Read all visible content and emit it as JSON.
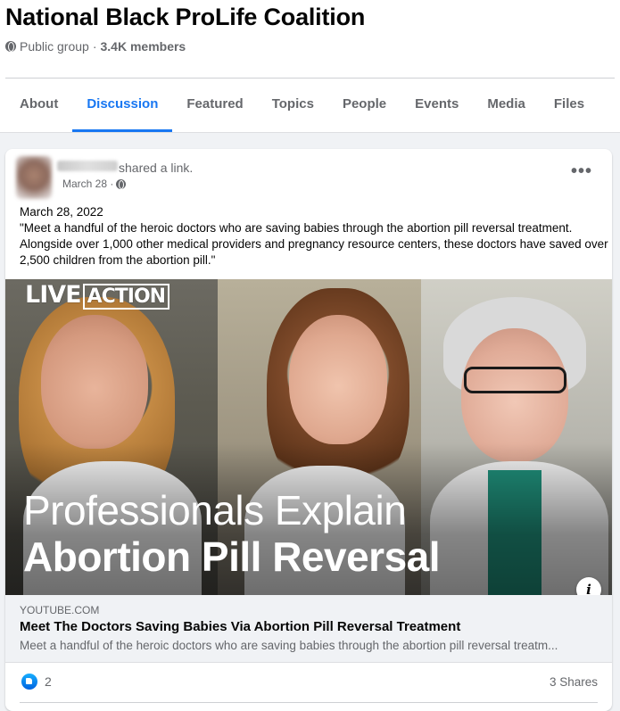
{
  "group": {
    "title": "National Black ProLife Coalition",
    "privacy": "Public group",
    "separator": "·",
    "members": "3.4K members"
  },
  "tabs": [
    {
      "label": "About",
      "active": false
    },
    {
      "label": "Discussion",
      "active": true
    },
    {
      "label": "Featured",
      "active": false
    },
    {
      "label": "Topics",
      "active": false
    },
    {
      "label": "People",
      "active": false
    },
    {
      "label": "Events",
      "active": false
    },
    {
      "label": "Media",
      "active": false
    },
    {
      "label": "Files",
      "active": false
    }
  ],
  "post": {
    "action": "shared a link.",
    "date": "March 28 ·",
    "more": "•••",
    "body_date": "March 28, 2022",
    "body_text": "\"Meet a handful of the heroic doctors who are saving babies through the abortion pill reversal treatment. Alongside over 1,000 other medical providers and pregnancy resource centers, these doctors have saved over 2,500 children from the abortion pill.\"",
    "media": {
      "logo_left": "LIVE",
      "logo_right": "ACTION",
      "headline_line1": "Professionals Explain",
      "headline_line2": "Abortion Pill Reversal",
      "info_label": "i"
    },
    "link": {
      "domain": "YOUTUBE.COM",
      "title": "Meet The Doctors Saving Babies Via Abortion Pill Reversal Treatment",
      "description": "Meet a handful of the heroic doctors who are saving babies through the abortion pill reversal treatm..."
    },
    "reactions": {
      "like_count": "2",
      "shares": "3 Shares"
    }
  },
  "colors": {
    "accent": "#1877f2",
    "secondary_text": "#65676b",
    "background": "#f0f2f5"
  }
}
